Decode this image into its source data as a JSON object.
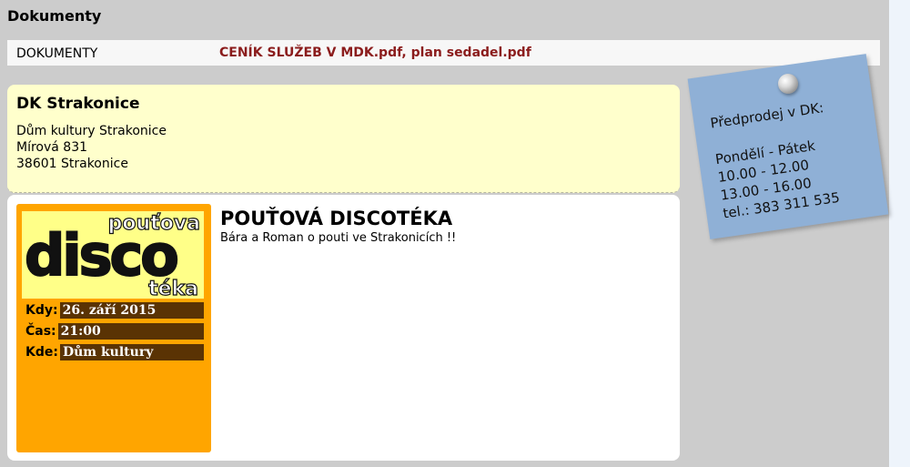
{
  "page": {
    "title": "Dokumenty"
  },
  "documents": {
    "label": "DOKUMENTY",
    "links": [
      "CENÍK SLUŽEB V MDK.pdf",
      "plan sedadel.pdf"
    ],
    "separator": ", "
  },
  "venue": {
    "title": "DK Strakonice",
    "lines": [
      "Dům kultury Strakonice",
      "Mírová 831",
      "38601 Strakonice"
    ]
  },
  "event": {
    "title": "POUŤOVÁ DISCOTÉKA",
    "description": "Bára a Roman o pouti ve Strakonicích !!",
    "poster": {
      "top": "pouťova",
      "main": "disco",
      "bottom": "téka"
    },
    "details": [
      {
        "key": "Kdy:",
        "value": "26. září 2015"
      },
      {
        "key": "Čas:",
        "value": "21:00"
      },
      {
        "key": "Kde:",
        "value": "Dům kultury"
      }
    ]
  },
  "presale_note": {
    "heading": "Předprodej v DK:",
    "days": "Pondělí - Pátek",
    "hours": [
      "10.00 - 12.00",
      "13.00 - 16.00"
    ],
    "phone": "tel.: 383 311 535"
  },
  "colors": {
    "background": "#cccccc",
    "docs_link": "#8b1c1c",
    "venue_box": "#ffffcc",
    "event_card": "#ffa500",
    "detail_row": "#5a3304",
    "note": "#8fb0d6"
  }
}
